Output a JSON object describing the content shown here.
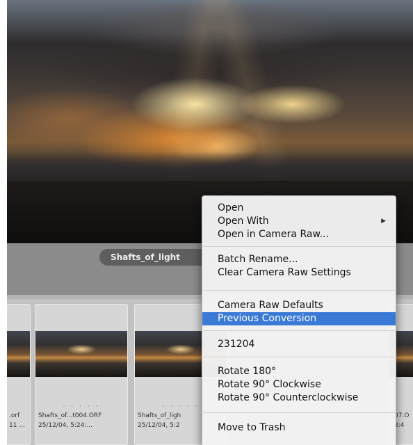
{
  "filename_pill": "Shafts_of_light",
  "thumbnails": [
    {
      "name": ".orf",
      "date": "11 ..."
    },
    {
      "name": "Shafts_of...t004.ORF",
      "date": "25/12/04, 5:24:..."
    },
    {
      "name": "Shafts_of_ligh",
      "date": "25/12/04, 5:2"
    },
    {
      "name": "07.O",
      "date": "8:4"
    }
  ],
  "rating_dots": "· · · · ·",
  "context_menu": {
    "items": [
      {
        "label": "Open"
      },
      {
        "label": "Open With",
        "submenu": true
      },
      {
        "label": "Open in Camera Raw..."
      },
      {
        "label": "Batch Rename..."
      },
      {
        "label": "Clear Camera Raw Settings"
      },
      {
        "label": "Camera Raw Defaults"
      },
      {
        "label": "Previous Conversion",
        "selected": true
      },
      {
        "label": "231204"
      },
      {
        "label": "Rotate 180°"
      },
      {
        "label": "Rotate 90° Clockwise"
      },
      {
        "label": "Rotate 90° Counterclockwise"
      },
      {
        "label": "Move to Trash"
      }
    ],
    "submenu_arrow": "▶"
  },
  "colors": {
    "selection": "#3a7ad6",
    "menu_background": "#f3f3f3",
    "strip_background": "#c2c2c2"
  }
}
